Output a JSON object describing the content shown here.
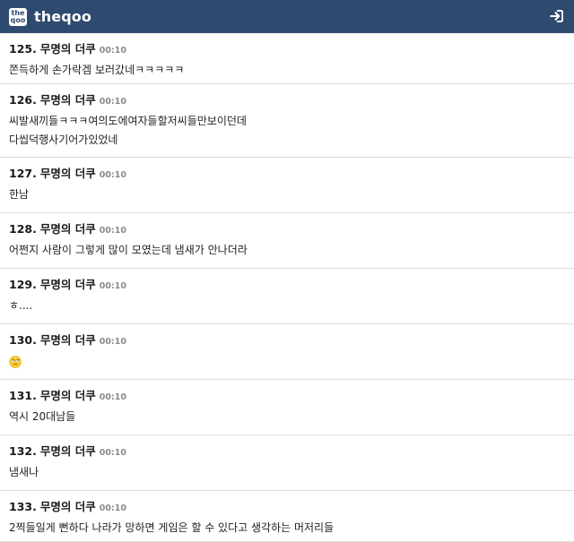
{
  "header": {
    "logo_line1": "the",
    "logo_line2": "qoo",
    "brand": "theqoo",
    "login_icon": "sign-in-icon",
    "bg_color": "#2f4a6f"
  },
  "comments": [
    {
      "num": "125.",
      "author": "무명의 더쿠",
      "time": "00:10",
      "lines": [
        "쫀득하게 손가락겜 보러갔네ㅋㅋㅋㅋㅋ"
      ]
    },
    {
      "num": "126.",
      "author": "무명의 더쿠",
      "time": "00:10",
      "lines": [
        "씨발새끼들ㅋㅋㅋ여의도에여자들할저씨들만보이던데",
        "다씹덕행사기어가있었네"
      ]
    },
    {
      "num": "127.",
      "author": "무명의 더쿠",
      "time": "00:10",
      "lines": [
        "한남"
      ]
    },
    {
      "num": "128.",
      "author": "무명의 더쿠",
      "time": "00:10",
      "lines": [
        "어쩐지 사람이 그렇게 많이 모였는데 냄새가 안나더라"
      ]
    },
    {
      "num": "129.",
      "author": "무명의 더쿠",
      "time": "00:10",
      "lines": [
        "ㅎ...."
      ]
    },
    {
      "num": "130.",
      "author": "무명의 더쿠",
      "time": "00:10",
      "emoji": "rolling-eyes-emoji-icon",
      "lines": []
    },
    {
      "num": "131.",
      "author": "무명의 더쿠",
      "time": "00:10",
      "lines": [
        "역시 20대남들"
      ]
    },
    {
      "num": "132.",
      "author": "무명의 더쿠",
      "time": "00:10",
      "lines": [
        "냄새나"
      ]
    },
    {
      "num": "133.",
      "author": "무명의 더쿠",
      "time": "00:10",
      "lines": [
        "2찍들일게 뻔하다 나라가 망하면 게임은 할 수 있다고 생각하는 머저리들"
      ]
    }
  ]
}
